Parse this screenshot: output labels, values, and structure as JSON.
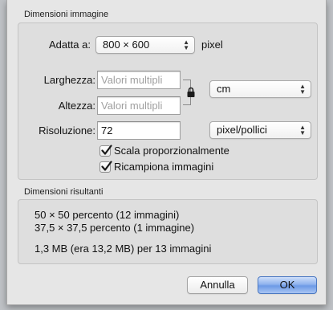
{
  "image_dimensions": {
    "title": "Dimensioni immagine",
    "fit_label": "Adatta a:",
    "fit_value": "800 × 600",
    "fit_unit": "pixel",
    "width_label": "Larghezza:",
    "width_placeholder": "Valori multipli",
    "height_label": "Altezza:",
    "height_placeholder": "Valori multipli",
    "size_unit": "cm",
    "resolution_label": "Risoluzione:",
    "resolution_value": "72",
    "resolution_unit": "pixel/pollici",
    "scale_label": "Scala proporzionalmente",
    "scale_checked": true,
    "resample_label": "Ricampiona immagini",
    "resample_checked": true
  },
  "resulting_dimensions": {
    "title": "Dimensioni risultanti",
    "lines": [
      "50 × 50 percento (12 immagini)",
      "37,5 × 37,5 percento (1 immagine)"
    ],
    "size_line": "1,3 MB (era 13,2 MB) per 13 immagini"
  },
  "buttons": {
    "cancel": "Annulla",
    "ok": "OK"
  },
  "colors": {
    "ok_button": "#6d9ae6",
    "checkmark": "#1a1a1a"
  }
}
